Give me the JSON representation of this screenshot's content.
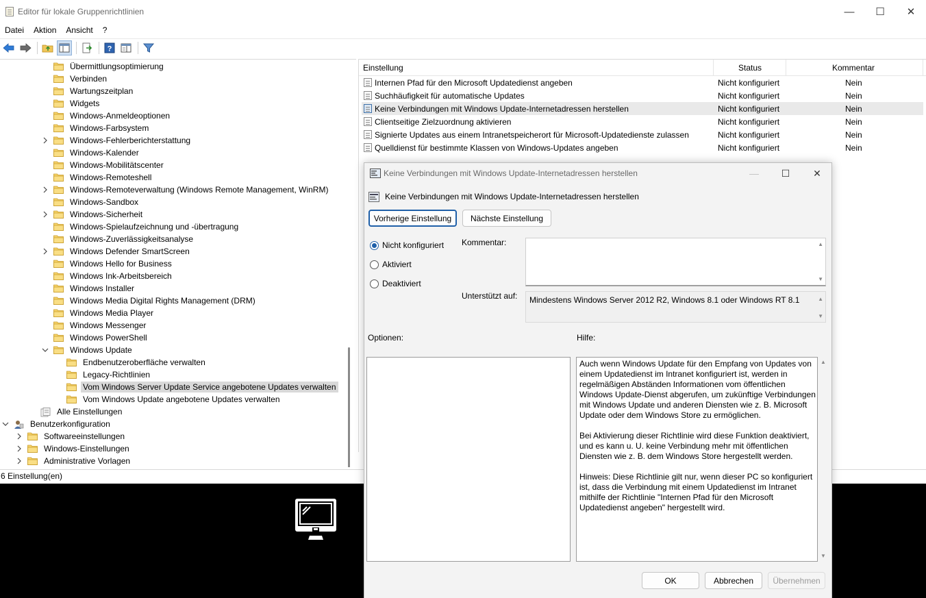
{
  "window": {
    "title": "Editor für lokale Gruppenrichtlinien",
    "controls": {
      "minimize": "—",
      "maximize": "☐",
      "close": "✕"
    }
  },
  "menu": [
    "Datei",
    "Aktion",
    "Ansicht",
    "?"
  ],
  "toolbar": [
    "back-icon",
    "forward-icon",
    "up-folder-icon",
    "show-hide-tree-icon",
    "export-list-icon",
    "help-icon",
    "extended-view-icon",
    "filter-icon"
  ],
  "tree": [
    {
      "label": "Übermittlungsoptimierung",
      "level": 3,
      "expandable": false
    },
    {
      "label": "Verbinden",
      "level": 3,
      "expandable": false
    },
    {
      "label": "Wartungszeitplan",
      "level": 3,
      "expandable": false
    },
    {
      "label": "Widgets",
      "level": 3,
      "expandable": false
    },
    {
      "label": "Windows-Anmeldeoptionen",
      "level": 3,
      "expandable": false
    },
    {
      "label": "Windows-Farbsystem",
      "level": 3,
      "expandable": false
    },
    {
      "label": "Windows-Fehlerberichterstattung",
      "level": 3,
      "expandable": true
    },
    {
      "label": "Windows-Kalender",
      "level": 3,
      "expandable": false
    },
    {
      "label": "Windows-Mobilitätscenter",
      "level": 3,
      "expandable": false
    },
    {
      "label": "Windows-Remoteshell",
      "level": 3,
      "expandable": false
    },
    {
      "label": "Windows-Remoteverwaltung (Windows Remote Management, WinRM)",
      "level": 3,
      "expandable": true
    },
    {
      "label": "Windows-Sandbox",
      "level": 3,
      "expandable": false
    },
    {
      "label": "Windows-Sicherheit",
      "level": 3,
      "expandable": true
    },
    {
      "label": "Windows-Spielaufzeichnung und -übertragung",
      "level": 3,
      "expandable": false
    },
    {
      "label": "Windows-Zuverlässigkeitsanalyse",
      "level": 3,
      "expandable": false
    },
    {
      "label": "Windows Defender SmartScreen",
      "level": 3,
      "expandable": true
    },
    {
      "label": "Windows Hello for Business",
      "level": 3,
      "expandable": false
    },
    {
      "label": "Windows Ink-Arbeitsbereich",
      "level": 3,
      "expandable": false
    },
    {
      "label": "Windows Installer",
      "level": 3,
      "expandable": false
    },
    {
      "label": "Windows Media Digital Rights Management (DRM)",
      "level": 3,
      "expandable": false
    },
    {
      "label": "Windows Media Player",
      "level": 3,
      "expandable": false
    },
    {
      "label": "Windows Messenger",
      "level": 3,
      "expandable": false
    },
    {
      "label": "Windows PowerShell",
      "level": 3,
      "expandable": false
    },
    {
      "label": "Windows Update",
      "level": 3,
      "expandable": true,
      "expanded": true
    },
    {
      "label": "Endbenutzeroberfläche verwalten",
      "level": 4,
      "expandable": false
    },
    {
      "label": "Legacy-Richtlinien",
      "level": 4,
      "expandable": false
    },
    {
      "label": "Vom Windows Server Update Service angebotene Updates verwalten",
      "level": 4,
      "expandable": false,
      "selected": true
    },
    {
      "label": "Vom Windows Update angebotene Updates verwalten",
      "level": 4,
      "expandable": false
    },
    {
      "label": "Alle Einstellungen",
      "level": 2,
      "expandable": false,
      "icon": "all-settings"
    },
    {
      "label": "Benutzerkonfiguration",
      "level": 0,
      "expandable": true,
      "expanded": true,
      "icon": "user-config"
    },
    {
      "label": "Softwareeinstellungen",
      "level": 1,
      "expandable": true
    },
    {
      "label": "Windows-Einstellungen",
      "level": 1,
      "expandable": true
    },
    {
      "label": "Administrative Vorlagen",
      "level": 1,
      "expandable": true
    }
  ],
  "list": {
    "columns": {
      "setting": "Einstellung",
      "status": "Status",
      "comment": "Kommentar"
    },
    "rows": [
      {
        "name": "Internen Pfad für den Microsoft Updatedienst angeben",
        "status": "Nicht konfiguriert",
        "comment": "Nein"
      },
      {
        "name": "Suchhäufigkeit für automatische Updates",
        "status": "Nicht konfiguriert",
        "comment": "Nein"
      },
      {
        "name": "Keine Verbindungen mit Windows Update-Internetadressen herstellen",
        "status": "Nicht konfiguriert",
        "comment": "Nein",
        "highlight": true
      },
      {
        "name": "Clientseitige Zielzuordnung aktivieren",
        "status": "Nicht konfiguriert",
        "comment": "Nein"
      },
      {
        "name": "Signierte Updates aus einem Intranetspeicherort für Microsoft-Updatedienste zulassen",
        "status": "Nicht konfiguriert",
        "comment": "Nein"
      },
      {
        "name": "Quelldienst für bestimmte Klassen von Windows-Updates angeben",
        "status": "Nicht konfiguriert",
        "comment": "Nein"
      }
    ]
  },
  "statusbar": "6 Einstellung(en)",
  "dialog": {
    "title": "Keine Verbindungen mit Windows Update-Internetadressen herstellen",
    "heading": "Keine Verbindungen mit Windows Update-Internetadressen herstellen",
    "prev_button": "Vorherige Einstellung",
    "next_button": "Nächste Einstellung",
    "radio": [
      {
        "label": "Nicht konfiguriert",
        "checked": true
      },
      {
        "label": "Aktiviert",
        "checked": false
      },
      {
        "label": "Deaktiviert",
        "checked": false
      }
    ],
    "comment_label": "Kommentar:",
    "comment_value": "",
    "supported_label": "Unterstützt auf:",
    "supported_value": "Mindestens Windows Server 2012 R2, Windows 8.1 oder Windows RT 8.1",
    "options_label": "Optionen:",
    "help_label": "Hilfe:",
    "help_text": "Auch wenn Windows Update für den Empfang von Updates von einem Updatedienst im Intranet konfiguriert ist, werden in regelmäßigen Abständen Informationen vom öffentlichen Windows Update-Dienst abgerufen, um zukünftige Verbindungen mit Windows Update und anderen Diensten wie z. B. Microsoft Update oder dem Windows Store zu ermöglichen.\n\nBei Aktivierung dieser Richtlinie wird diese Funktion deaktiviert, und es kann u. U. keine Verbindung mehr mit öffentlichen Diensten wie z. B. dem Windows Store hergestellt werden.\n\nHinweis: Diese Richtlinie gilt nur, wenn dieser PC so konfiguriert ist, dass die Verbindung mit einem Updatedienst im Intranet mithilfe der Richtlinie \"Internen Pfad für den Microsoft Updatedienst angeben\" hergestellt wird.",
    "ok_button": "OK",
    "cancel_button": "Abbrechen",
    "apply_button": "Übernehmen"
  },
  "colors": {
    "accent": "#1f5fa8",
    "folder": "#f0c659",
    "selection": "#d9d9d9"
  }
}
